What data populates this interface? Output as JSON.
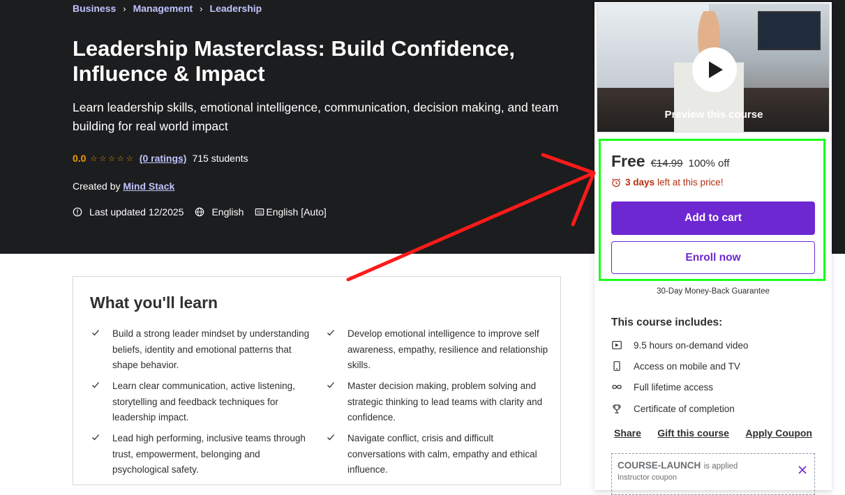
{
  "breadcrumb": [
    "Business",
    "Management",
    "Leadership"
  ],
  "course": {
    "title": "Leadership Masterclass: Build Confidence, Influence & Impact",
    "subtitle": "Learn leadership skills, emotional intelligence, communication, decision making, and team building for real world impact",
    "rating": "0.0",
    "stars_filled": 0,
    "stars_total": 5,
    "ratings_link": "(0 ratings)",
    "students": "715 students",
    "created_by_label": "Created by",
    "author": "Mind Stack",
    "last_updated": "Last updated 12/2025",
    "language": "English",
    "captions": "English [Auto]"
  },
  "learn": {
    "title": "What you'll learn",
    "items": [
      "Build a strong leader mindset by understanding beliefs, identity and emotional patterns that shape behavior.",
      "Develop emotional intelligence to improve self awareness, empathy, resilience and relationship skills.",
      "Learn clear communication, active listening, storytelling and feedback techniques for leadership impact.",
      "Master decision making, problem solving and strategic thinking to lead teams with clarity and confidence.",
      "Lead high performing, inclusive teams through trust, empowerment, belonging and psychological safety.",
      "Navigate conflict, crisis and difficult conversations with calm, empathy and ethical influence."
    ]
  },
  "sidebar": {
    "preview_label": "Preview this course",
    "price": "Free",
    "original_price": "€14.99",
    "discount": "100% off",
    "countdown_days": "3 days",
    "countdown_rest": "left at this price!",
    "add_to_cart": "Add to cart",
    "enroll_now": "Enroll now",
    "guarantee": "30-Day Money-Back Guarantee",
    "includes_title": "This course includes:",
    "includes": [
      {
        "icon": "video-icon",
        "label": "9.5 hours on-demand video"
      },
      {
        "icon": "mobile-icon",
        "label": "Access on mobile and TV"
      },
      {
        "icon": "infinity-icon",
        "label": "Full lifetime access"
      },
      {
        "icon": "trophy-icon",
        "label": "Certificate of completion"
      }
    ],
    "share": "Share",
    "gift": "Gift this course",
    "apply_coupon": "Apply Coupon",
    "coupon_code": "COURSE-LAUNCH",
    "coupon_applied": "is applied",
    "coupon_sub": "Instructor coupon"
  },
  "colors": {
    "hero_bg": "#1c1d1f",
    "accent_purple": "#6d28d2",
    "link_lavender": "#c0c4fc",
    "star_orange": "#f69c08",
    "countdown_red": "#b32d0f",
    "annotation_green": "#1aff1a",
    "annotation_red": "#ff1a1a"
  }
}
